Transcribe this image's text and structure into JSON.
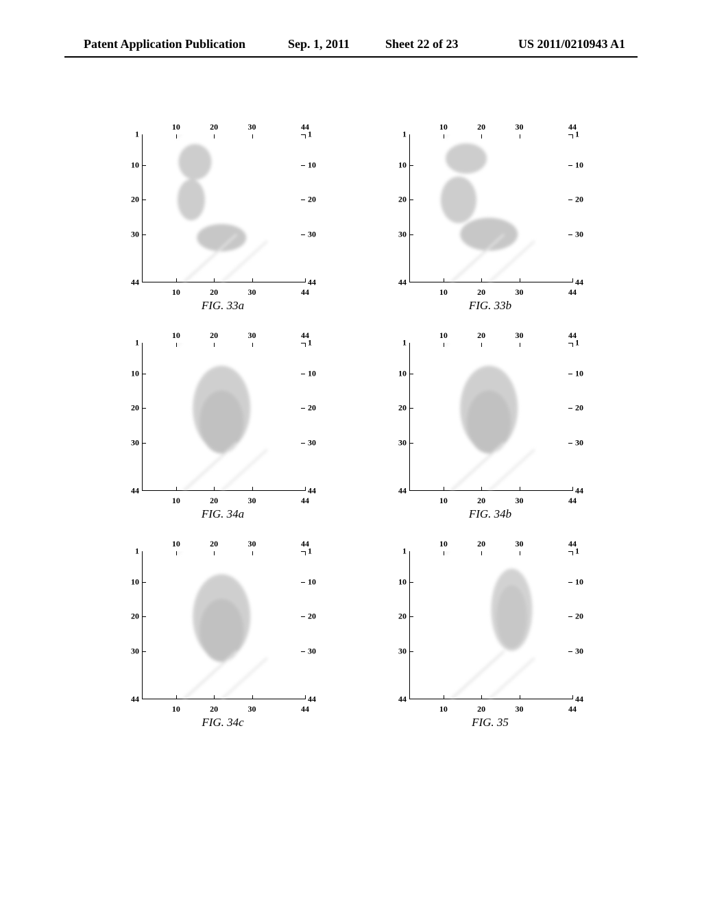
{
  "header": {
    "left": "Patent Application Publication",
    "date": "Sep. 1, 2011",
    "sheet": "Sheet 22 of 23",
    "pubno": "US 2011/0210943 A1"
  },
  "axis": {
    "ticks": [
      "1",
      "10",
      "20",
      "30",
      "44"
    ],
    "min": 1,
    "max": 44
  },
  "plots": [
    {
      "caption": "FIG. 33a",
      "shape": "curve-left"
    },
    {
      "caption": "FIG. 33b",
      "shape": "curve-wide"
    },
    {
      "caption": "FIG. 34a",
      "shape": "oval-center"
    },
    {
      "caption": "FIG. 34b",
      "shape": "oval-center"
    },
    {
      "caption": "FIG. 34c",
      "shape": "oval-center"
    },
    {
      "caption": "FIG. 35",
      "shape": "oval-right"
    }
  ],
  "chart_data": [
    {
      "type": "heatmap",
      "title": "FIG. 33a",
      "xlabel": "",
      "ylabel": "",
      "xlim": [
        1,
        44
      ],
      "ylim": [
        1,
        44
      ],
      "note": "tactile blob image, curved shape upper-left, intensity grayscale"
    },
    {
      "type": "heatmap",
      "title": "FIG. 33b",
      "xlabel": "",
      "ylabel": "",
      "xlim": [
        1,
        44
      ],
      "ylim": [
        1,
        44
      ],
      "note": "tactile blob image, wider curved shape, intensity grayscale"
    },
    {
      "type": "heatmap",
      "title": "FIG. 34a",
      "xlabel": "",
      "ylabel": "",
      "xlim": [
        1,
        44
      ],
      "ylim": [
        1,
        44
      ],
      "note": "tactile blob image, oval centered, intensity grayscale"
    },
    {
      "type": "heatmap",
      "title": "FIG. 34b",
      "xlabel": "",
      "ylabel": "",
      "xlim": [
        1,
        44
      ],
      "ylim": [
        1,
        44
      ],
      "note": "tactile blob image, oval centered, intensity grayscale"
    },
    {
      "type": "heatmap",
      "title": "FIG. 34c",
      "xlabel": "",
      "ylabel": "",
      "xlim": [
        1,
        44
      ],
      "ylim": [
        1,
        44
      ],
      "note": "tactile blob image, oval centered, intensity grayscale"
    },
    {
      "type": "heatmap",
      "title": "FIG. 35",
      "xlabel": "",
      "ylabel": "",
      "xlim": [
        1,
        44
      ],
      "ylim": [
        1,
        44
      ],
      "note": "tactile blob image, vertical oval right side, intensity grayscale"
    }
  ]
}
